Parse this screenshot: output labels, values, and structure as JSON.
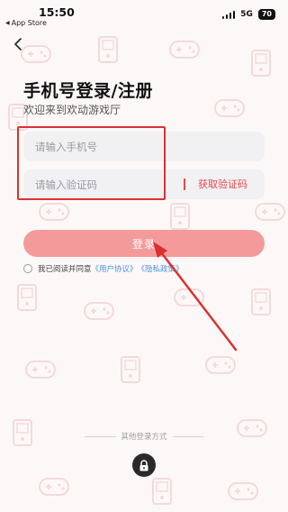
{
  "status_bar": {
    "time": "15:50",
    "back_app": "App Store",
    "network": "5G",
    "battery": "70"
  },
  "header": {
    "title": "手机号登录/注册",
    "subtitle": "欢迎来到欢动游戏厅"
  },
  "form": {
    "phone_placeholder": "请输入手机号",
    "phone_value": "",
    "code_placeholder": "请输入验证码",
    "code_value": "",
    "get_code_label": "获取验证码"
  },
  "login_button": "登录",
  "agreement": {
    "prefix": "我已阅读并同意",
    "user_agreement": "《用户协议》",
    "privacy_policy": "《隐私政策》",
    "checked": false
  },
  "other_login": {
    "label": "其他登录方式"
  },
  "icons": {
    "back": "chevron-left-icon",
    "lock": "lock-icon",
    "battery": "battery-icon",
    "signal": "signal-icon"
  },
  "colors": {
    "accent": "#e34a4a",
    "login_button": "#f59a9a",
    "link": "#4a90e2",
    "highlight": "#e03030",
    "background": "#fdf8f8",
    "field": "#f1f1f4"
  }
}
